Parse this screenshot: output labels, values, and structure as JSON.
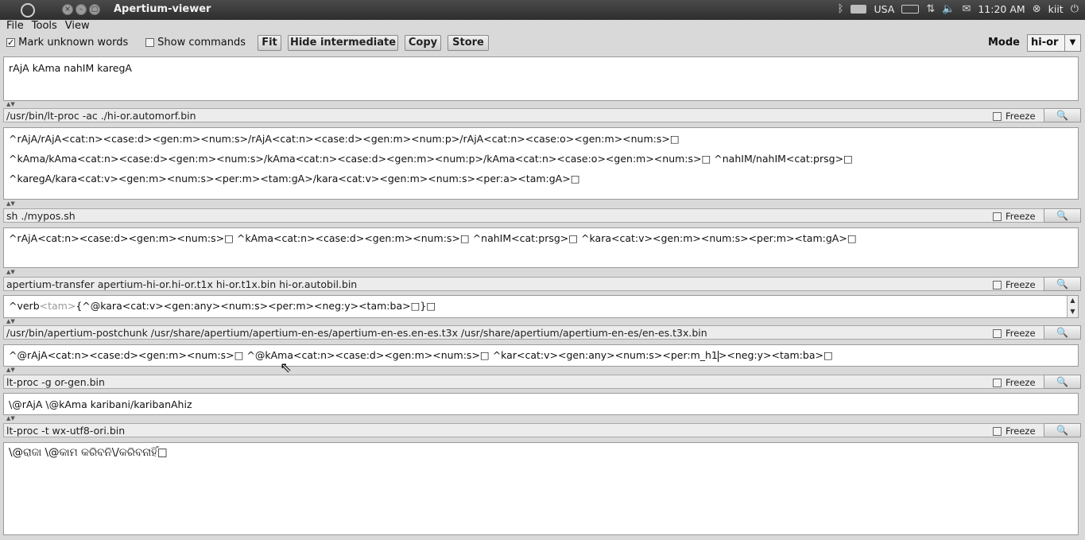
{
  "topbar": {
    "title": "Apertium-viewer",
    "tray": {
      "keyboard": "USA",
      "time": "11:20 AM",
      "user": "kiit"
    }
  },
  "menu": [
    "File",
    "Tools",
    "View"
  ],
  "toolbar": {
    "mark_unknown": "Mark unknown words",
    "show_commands": "Show commands",
    "fit": "Fit",
    "hide_intermediate": "Hide intermediate",
    "copy": "Copy",
    "store": "Store",
    "mode_label": "Mode",
    "mode_value": "hi-or"
  },
  "input_text": "rAjA kAma nahIM karegA",
  "freeze_label": "Freeze",
  "stages": [
    {
      "command": "/usr/bin/lt-proc -ac ./hi-or.automorf.bin",
      "lines": [
        "^rAjA/rAjA<cat:n><case:d><gen:m><num:s>/rAjA<cat:n><case:d><gen:m><num:p>/rAjA<cat:n><case:o><gen:m><num:s>□",
        "^kAma/kAma<cat:n><case:d><gen:m><num:s>/kAma<cat:n><case:d><gen:m><num:p>/kAma<cat:n><case:o><gen:m><num:s>□  ^nahIM/nahIM<cat:prsg>□",
        "^karegA/kara<cat:v><gen:m><num:s><per:m><tam:gA>/kara<cat:v><gen:m><num:s><per:a><tam:gA>□"
      ]
    },
    {
      "command": "sh ./mypos.sh",
      "lines": [
        "^rAjA<cat:n><case:d><gen:m><num:s>□  ^kAma<cat:n><case:d><gen:m><num:s>□  ^nahIM<cat:prsg>□  ^kara<cat:v><gen:m><num:s><per:m><tam:gA>□"
      ]
    },
    {
      "command": "apertium-transfer apertium-hi-or.hi-or.t1x  hi-or.t1x.bin  hi-or.autobil.bin",
      "lines": [],
      "prefix": "^verb",
      "faded": "<tam>",
      "rest": "{^@kara<cat:v><gen:any><num:s><per:m><neg:y><tam:ba>□}□"
    },
    {
      "command": "/usr/bin/apertium-postchunk /usr/share/apertium/apertium-en-es/apertium-en-es.en-es.t3x  /usr/share/apertium/apertium-en-es/en-es.t3x.bin",
      "lines": [],
      "before_caret": "^@rAjA<cat:n><case:d><gen:m><num:s>□  ^@kAma<cat:n><case:d><gen:m><num:s>□  ^kar<cat:v><gen:any><num:s><per:m_h1",
      "after_caret": "><neg:y><tam:ba>□"
    },
    {
      "command": " lt-proc -g or-gen.bin",
      "lines": [
        "\\@rAjA  \\@kAma  karibani/karibanAhiz"
      ]
    },
    {
      "command": "lt-proc -t wx-utf8-ori.bin",
      "lines": [
        "\\@ରାଜା  \\@କାମ  କରିବନି\\/କରିବନାହିଁ□"
      ]
    }
  ]
}
